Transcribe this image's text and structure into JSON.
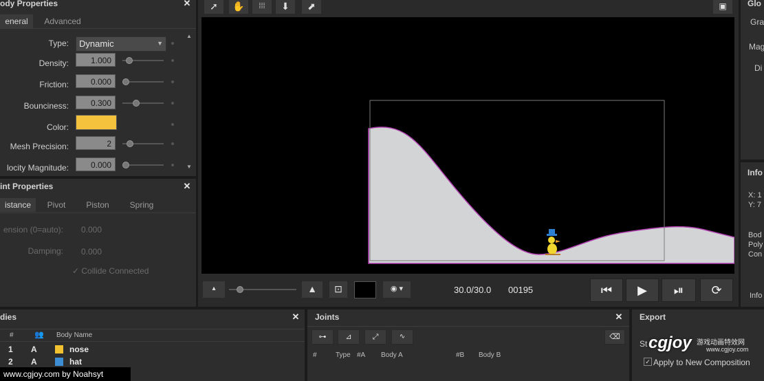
{
  "body_properties": {
    "title": "ody Properties",
    "tabs": [
      "eneral",
      "Advanced"
    ],
    "type_label": "Type:",
    "type_value": "Dynamic",
    "rows": [
      {
        "label": "Density:",
        "value": "1.000",
        "slider": 0.08
      },
      {
        "label": "Friction:",
        "value": "0.000",
        "slider": 0.0
      },
      {
        "label": "Bounciness:",
        "value": "0.300",
        "slider": 0.25
      },
      {
        "label": "Color:",
        "value": "",
        "swatch": "#f5c23e"
      },
      {
        "label": "Mesh Precision:",
        "value": "2",
        "slider": 0.1
      },
      {
        "label": "locity Magnitude:",
        "value": "0.000",
        "slider": 0.0
      }
    ]
  },
  "joint_properties": {
    "title": "int Properties",
    "tabs": [
      "istance",
      "Pivot",
      "Piston",
      "Spring"
    ],
    "rows": [
      {
        "label": "ension (0=auto):",
        "value": "0.000"
      },
      {
        "label": "Damping:",
        "value": "0.000"
      }
    ],
    "collide": "✓ Collide Connected"
  },
  "viewport": {
    "timecode": "30.0/30.0",
    "frame": "00195"
  },
  "global_panel": {
    "title": "Glo",
    "items": [
      "Gra",
      "Mag",
      "Di"
    ]
  },
  "info_panel": {
    "title": "Info",
    "lines": [
      "X: 1",
      "Y: 7",
      "Bod",
      "Poly",
      "Con"
    ],
    "footer": "Info"
  },
  "bodies": {
    "title": "dies",
    "headers": [
      "#",
      "Body Name"
    ],
    "rows": [
      {
        "num": "1",
        "type": "A",
        "color": "#f2c230",
        "name": "nose"
      },
      {
        "num": "2",
        "type": "A",
        "color": "#3e8ed6",
        "name": "hat"
      }
    ]
  },
  "joints": {
    "title": "Joints",
    "headers": [
      "#",
      "Type",
      "#A",
      "Body A",
      "#B",
      "Body B"
    ]
  },
  "export": {
    "title": "Export",
    "partial": "St",
    "apply": "Apply to New Composition"
  },
  "watermark": {
    "logo": "cgjoy",
    "chinese": "游戏动画特效网",
    "url_small": "www.cgjoy.com",
    "credit": "www.cgjoy.com by Noahsyt"
  },
  "colors": {
    "canvas": "#000000",
    "terrain": "#d2d4d6",
    "terrain_edge": "#b03fb0",
    "swatch": "#f5c23e"
  }
}
